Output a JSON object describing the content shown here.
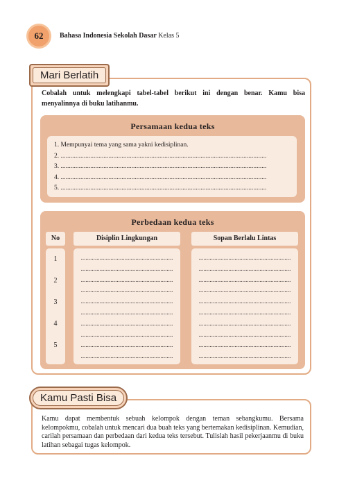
{
  "header": {
    "page_number": "62",
    "book_title": "Bahasa Indonesia Sekolah Dasar",
    "class_label": "Kelas 5"
  },
  "practice": {
    "heading": "Mari Berlatih",
    "instruction": "Cobalah untuk melengkapi tabel-tabel berikut ini dengan benar. Kamu bisa menyalinnya di buku latihanmu.",
    "similarities": {
      "title": "Persamaan kedua teks",
      "items": [
        "1.  Mempunyai tema yang sama yakni kedisiplinan.",
        "2.  .............................................................................................................................",
        "3.  .............................................................................................................................",
        "4.  .............................................................................................................................",
        "5.  ............................................................................................................................."
      ]
    },
    "differences": {
      "title": "Perbedaan kedua teks",
      "col_no": "No",
      "col_a": "Disiplin Lingkungan",
      "col_b": "Sopan Berlalu Lintas",
      "numbers": [
        "1",
        "2",
        "3",
        "4",
        "5"
      ],
      "blank": "..........................................................."
    }
  },
  "group_task": {
    "heading": "Kamu Pasti Bisa",
    "text": "Kamu dapat membentuk sebuah kelompok dengan teman sebangkumu. Bersama kelompokmu, cobalah untuk mencari dua buah teks yang bertemakan kedisiplinan. Kemudian, carilah persamaan dan perbedaan dari kedua teks tersebut. Tulislah hasil pekerjaanmu di buku latihan sebagai tugas kelompok."
  }
}
